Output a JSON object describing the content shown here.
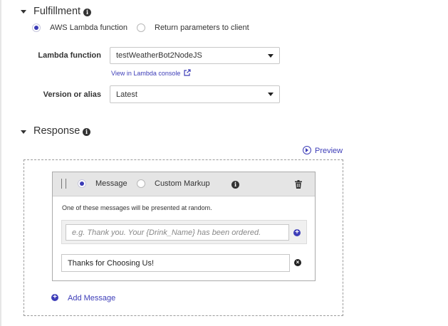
{
  "fulfillment": {
    "title": "Fulfillment",
    "options": [
      {
        "label": "AWS Lambda function",
        "selected": true
      },
      {
        "label": "Return parameters to client",
        "selected": false
      }
    ],
    "lambda_label": "Lambda function",
    "lambda_value": "testWeatherBot2NodeJS",
    "console_link": "View in Lambda console",
    "version_label": "Version or alias",
    "version_value": "Latest"
  },
  "response": {
    "title": "Response",
    "preview_label": "Preview",
    "card": {
      "message_label": "Message",
      "message_selected": true,
      "custom_label": "Custom Markup",
      "hint": "One of these messages will be presented at random.",
      "input_placeholder": "e.g. Thank you. Your {Drink_Name} has been ordered.",
      "messages": [
        "Thanks for Choosing Us!"
      ]
    },
    "add_message_label": "Add Message"
  },
  "colors": {
    "accent": "#3d3db8",
    "header_bg": "#e5e5e5",
    "border": "#c7c7c7"
  }
}
